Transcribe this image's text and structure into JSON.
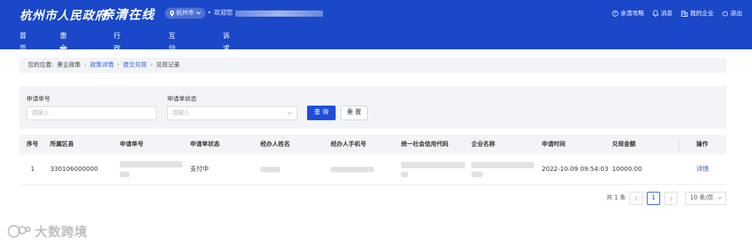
{
  "header": {
    "logo_primary": "杭州市人民政府",
    "logo_secondary": "亲清在线",
    "city": "杭州市",
    "welcome": "欢迎您",
    "links": [
      "亲清攻略",
      "消息",
      "我的企业",
      "退出"
    ],
    "nav": [
      "首页",
      "惠企政策",
      "行政许可",
      "互动交流",
      "诉求直达"
    ],
    "active_nav": "惠企政策"
  },
  "breadcrumb": {
    "prefix": "您的位置:",
    "items": [
      "惠企政策",
      "政策详情",
      "提交兑现",
      "兑现记录"
    ]
  },
  "filters": {
    "apply_no_label": "申请单号",
    "apply_no_placeholder": "请输入",
    "status_label": "申请单状态",
    "status_placeholder": "请输入",
    "query_button": "查 询",
    "reset_button": "重 置"
  },
  "table": {
    "columns": [
      "序号",
      "所属区县",
      "申请单号",
      "申请单状态",
      "经办人姓名",
      "经办人手机号",
      "统一社会信用代码",
      "企业名称",
      "申请时间",
      "兑现金额",
      "操作"
    ],
    "rows": [
      {
        "index": "1",
        "district": "330106000000",
        "status": "支付中",
        "apply_time": "2022-10-09 09:54:03",
        "amount": "10000.00",
        "action": "详情"
      }
    ]
  },
  "pagination": {
    "total": "共 1 条",
    "current_page": "1",
    "page_size": "10 条/页"
  },
  "watermark": "大数跨境",
  "colors": {
    "header_bg": "#1a48c8",
    "primary": "#1d4ed8",
    "panel_bg": "#f2f4f7"
  }
}
